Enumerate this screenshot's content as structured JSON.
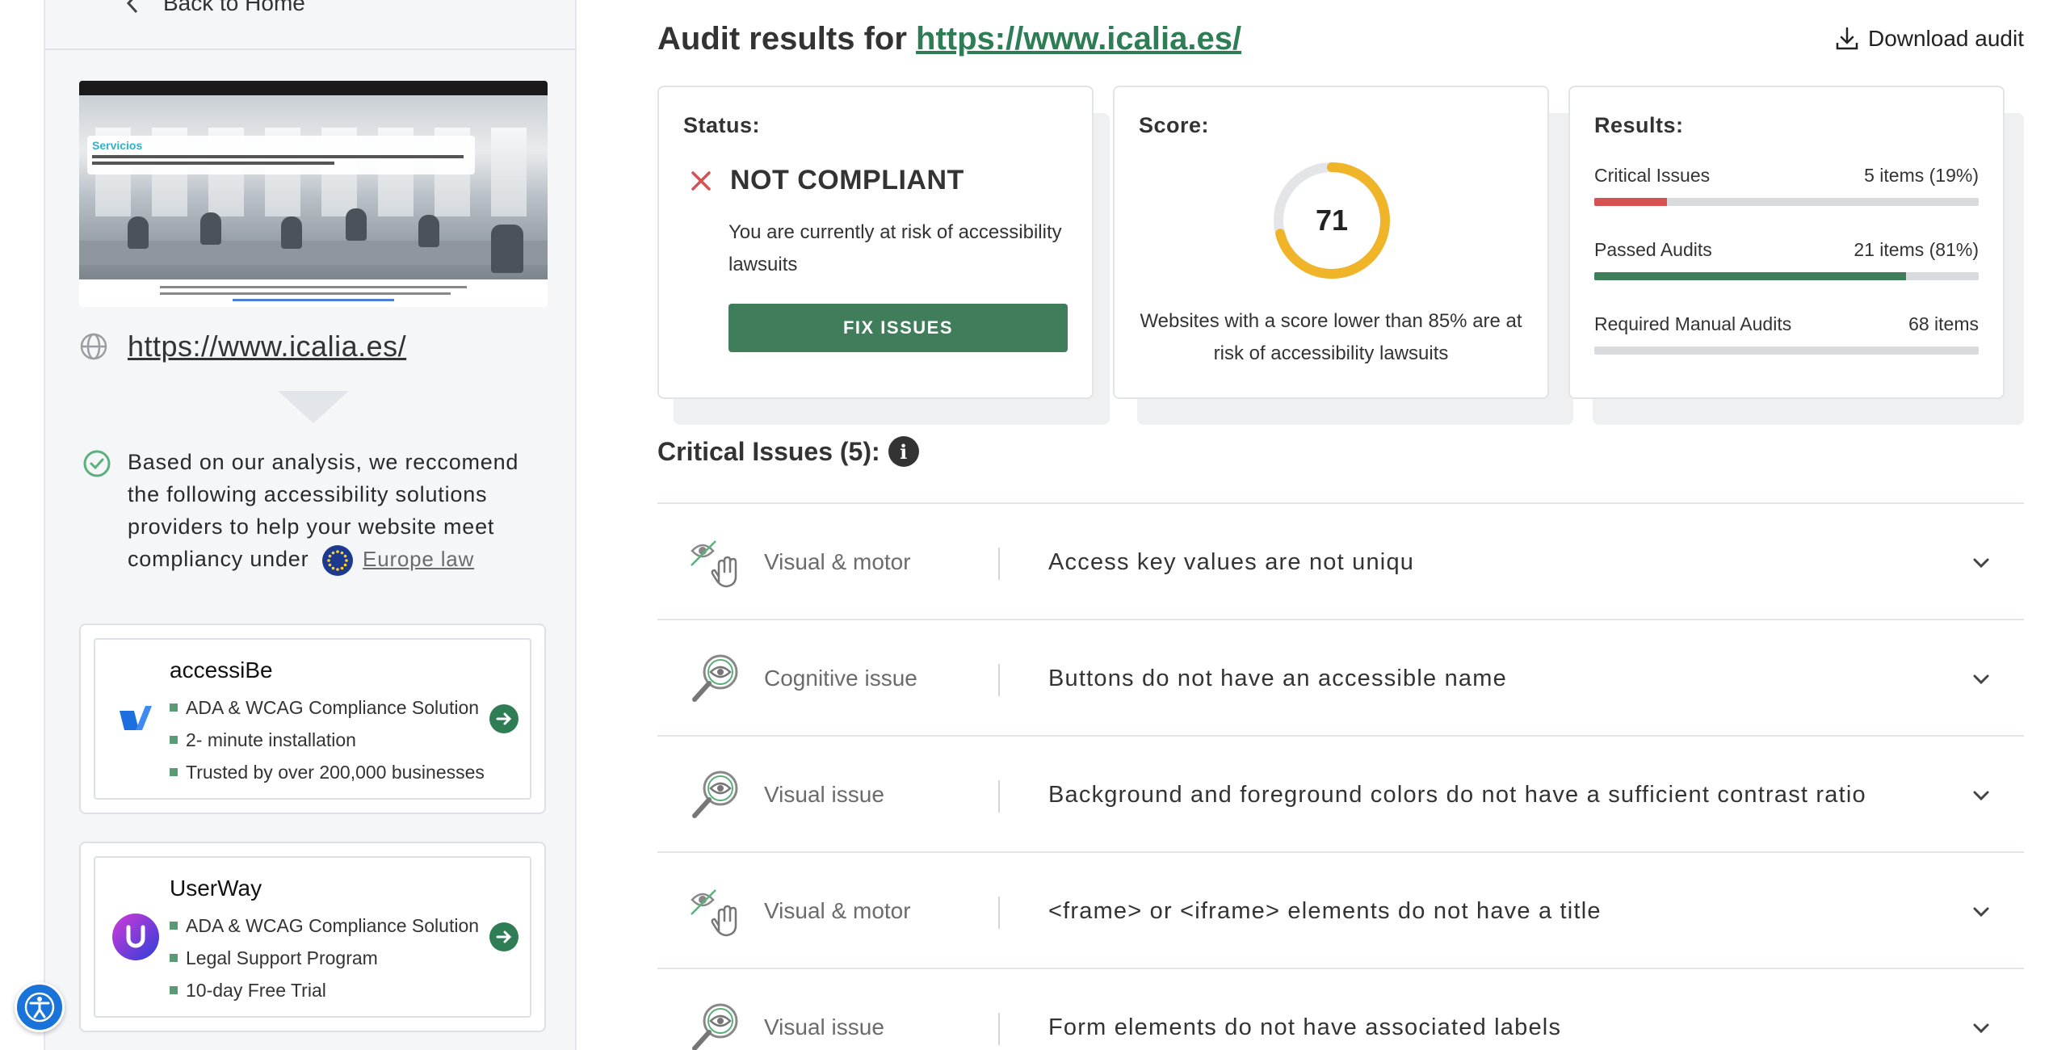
{
  "sidebar": {
    "back_label": "Back to Home",
    "thumbnail": {
      "heading": "Servicios",
      "tagline": "Proporcionamos soluciones y servicios tecnológicos integrales que siempre se ajustan a las normas reconocidas a nivel mundial y a las últimas tendencias tecnológicas."
    },
    "site_url": "https://www.icalia.es/",
    "recommend_text": "Based on our analysis, we reccomend the following accessibility solutions providers to help your website meet compliancy under",
    "law_link": "Europe law",
    "vendors": [
      {
        "name": "accessiBe",
        "features": [
          "ADA & WCAG Compliance Solution",
          "2- minute installation",
          "Trusted by over 200,000 businesses"
        ]
      },
      {
        "name": "UserWay",
        "features": [
          "ADA & WCAG Compliance Solution",
          "Legal Support Program",
          "10-day Free Trial"
        ]
      }
    ]
  },
  "header": {
    "title_prefix": "Audit results for",
    "title_url": "https://www.icalia.es/",
    "download_label": "Download audit"
  },
  "status": {
    "label": "Status:",
    "value": "NOT COMPLIANT",
    "description": "You are currently at risk of accessibility lawsuits",
    "button": "FIX ISSUES"
  },
  "score": {
    "label": "Score:",
    "value": "71",
    "fraction": 0.71,
    "description": "Websites with a score lower than 85% are at risk of accessibility lawsuits"
  },
  "results": {
    "label": "Results:",
    "rows": [
      {
        "name": "Critical Issues",
        "value": "5 items (19%)",
        "fraction": 0.19,
        "color": "#d65151"
      },
      {
        "name": "Passed Audits",
        "value": "21 items (81%)",
        "fraction": 0.81,
        "color": "#3f7d5b"
      },
      {
        "name": "Required Manual Audits",
        "value": "68 items",
        "fraction": 0,
        "color": "#c8cbce"
      }
    ]
  },
  "critical": {
    "title": "Critical Issues (5):",
    "info_icon": "i",
    "issues": [
      {
        "category": "Visual & motor",
        "icon": "eye-hand-icon",
        "title": "Access key values are not uniqu"
      },
      {
        "category": "Cognitive issue",
        "icon": "magnifier-eye-icon",
        "title": "Buttons do not have an accessible name"
      },
      {
        "category": "Visual issue",
        "icon": "magnifier-eye-icon",
        "title": "Background and foreground colors do not have a sufficient contrast ratio"
      },
      {
        "category": "Visual & motor",
        "icon": "eye-hand-icon",
        "title": "<frame> or <iframe> elements do not have a title"
      },
      {
        "category": "Visual issue",
        "icon": "magnifier-eye-icon",
        "title": "Form elements do not have associated labels"
      }
    ]
  },
  "colors": {
    "accent_green": "#2e7d55",
    "button_green": "#3f7d5b",
    "critical_red": "#d65151",
    "score_gold": "#f0b429",
    "a11y_blue": "#1a73d9"
  }
}
